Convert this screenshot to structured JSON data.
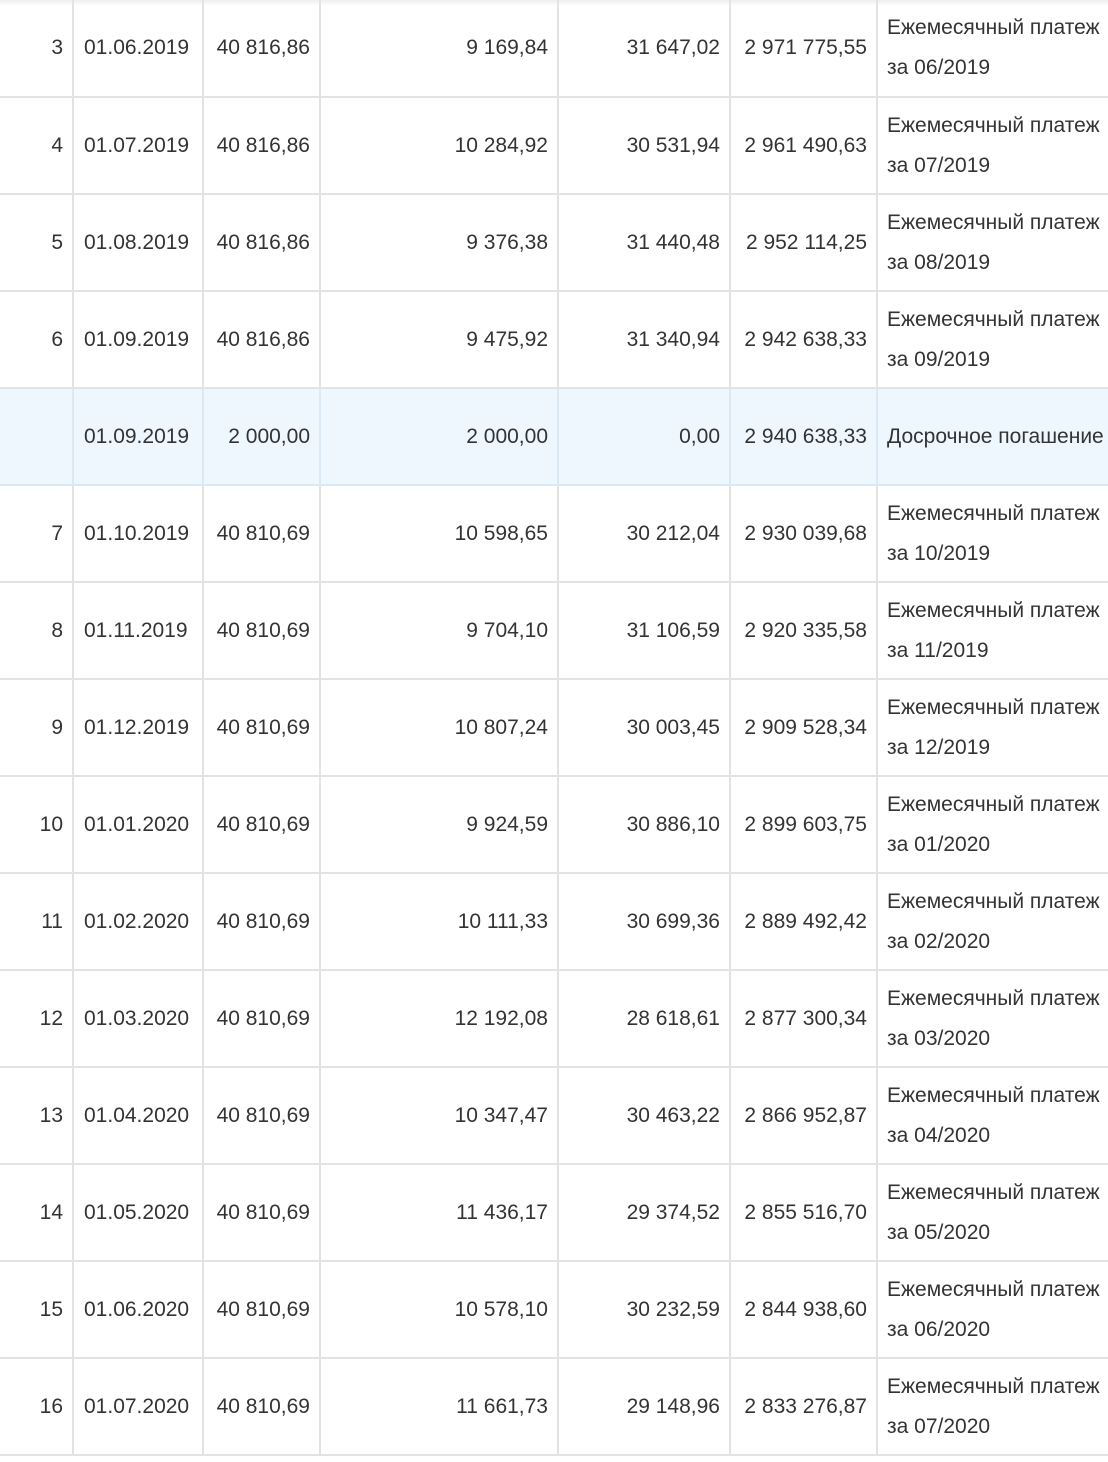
{
  "rows": [
    {
      "n": "3",
      "date": "01.06.2019",
      "payment": "40 816,86",
      "principal": "9 169,84",
      "interest": "31 647,02",
      "balance": "2 971 775,55",
      "comment": "Ежемесячный платеж за 06/2019",
      "early": false
    },
    {
      "n": "4",
      "date": "01.07.2019",
      "payment": "40 816,86",
      "principal": "10 284,92",
      "interest": "30 531,94",
      "balance": "2 961 490,63",
      "comment": "Ежемесячный платеж за 07/2019",
      "early": false
    },
    {
      "n": "5",
      "date": "01.08.2019",
      "payment": "40 816,86",
      "principal": "9 376,38",
      "interest": "31 440,48",
      "balance": "2 952 114,25",
      "comment": "Ежемесячный платеж за 08/2019",
      "early": false
    },
    {
      "n": "6",
      "date": "01.09.2019",
      "payment": "40 816,86",
      "principal": "9 475,92",
      "interest": "31 340,94",
      "balance": "2 942 638,33",
      "comment": "Ежемесячный платеж за 09/2019",
      "early": false
    },
    {
      "n": "",
      "date": "01.09.2019",
      "payment": "2 000,00",
      "principal": "2 000,00",
      "interest": "0,00",
      "balance": "2 940 638,33",
      "comment": "Досрочное погашение",
      "early": true
    },
    {
      "n": "7",
      "date": "01.10.2019",
      "payment": "40 810,69",
      "principal": "10 598,65",
      "interest": "30 212,04",
      "balance": "2 930 039,68",
      "comment": "Ежемесячный платеж за 10/2019",
      "early": false
    },
    {
      "n": "8",
      "date": "01.11.2019",
      "payment": "40 810,69",
      "principal": "9 704,10",
      "interest": "31 106,59",
      "balance": "2 920 335,58",
      "comment": "Ежемесячный платеж за 11/2019",
      "early": false
    },
    {
      "n": "9",
      "date": "01.12.2019",
      "payment": "40 810,69",
      "principal": "10 807,24",
      "interest": "30 003,45",
      "balance": "2 909 528,34",
      "comment": "Ежемесячный платеж за 12/2019",
      "early": false
    },
    {
      "n": "10",
      "date": "01.01.2020",
      "payment": "40 810,69",
      "principal": "9 924,59",
      "interest": "30 886,10",
      "balance": "2 899 603,75",
      "comment": "Ежемесячный платеж за 01/2020",
      "early": false
    },
    {
      "n": "11",
      "date": "01.02.2020",
      "payment": "40 810,69",
      "principal": "10 111,33",
      "interest": "30 699,36",
      "balance": "2 889 492,42",
      "comment": "Ежемесячный платеж за 02/2020",
      "early": false
    },
    {
      "n": "12",
      "date": "01.03.2020",
      "payment": "40 810,69",
      "principal": "12 192,08",
      "interest": "28 618,61",
      "balance": "2 877 300,34",
      "comment": "Ежемесячный платеж за 03/2020",
      "early": false
    },
    {
      "n": "13",
      "date": "01.04.2020",
      "payment": "40 810,69",
      "principal": "10 347,47",
      "interest": "30 463,22",
      "balance": "2 866 952,87",
      "comment": "Ежемесячный платеж за 04/2020",
      "early": false
    },
    {
      "n": "14",
      "date": "01.05.2020",
      "payment": "40 810,69",
      "principal": "11 436,17",
      "interest": "29 374,52",
      "balance": "2 855 516,70",
      "comment": "Ежемесячный платеж за 05/2020",
      "early": false
    },
    {
      "n": "15",
      "date": "01.06.2020",
      "payment": "40 810,69",
      "principal": "10 578,10",
      "interest": "30 232,59",
      "balance": "2 844 938,60",
      "comment": "Ежемесячный платеж за 06/2020",
      "early": false
    },
    {
      "n": "16",
      "date": "01.07.2020",
      "payment": "40 810,69",
      "principal": "11 661,73",
      "interest": "29 148,96",
      "balance": "2 833 276,87",
      "comment": "Ежемесячный платеж за 07/2020",
      "early": false
    }
  ],
  "colors": {
    "text": "#333333",
    "grid": "#e3e3e3",
    "early_row_bg": "#eef6fe"
  }
}
